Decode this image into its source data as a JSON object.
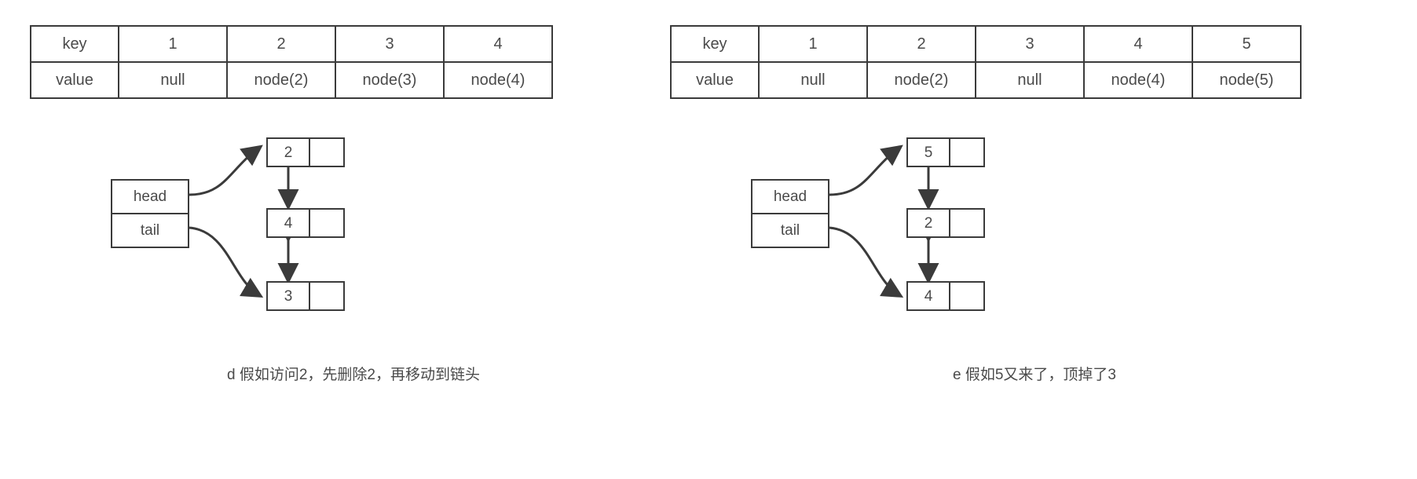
{
  "background_color": "#ffffff",
  "stroke_color": "#3b3b3b",
  "text_color": "#4a4a4a",
  "panels": [
    {
      "id": "d",
      "table": {
        "rows": [
          {
            "header": "key",
            "cells": [
              "1",
              "2",
              "3",
              "4"
            ]
          },
          {
            "header": "value",
            "cells": [
              "null",
              "node(2)",
              "node(3)",
              "node(4)"
            ]
          }
        ]
      },
      "list_box": {
        "head_label": "head",
        "tail_label": "tail"
      },
      "nodes": [
        {
          "value": "2",
          "position": "top"
        },
        {
          "value": "4",
          "position": "middle"
        },
        {
          "value": "3",
          "position": "bottom"
        }
      ],
      "caption": "d 假如访问2，先删除2，再移动到链头"
    },
    {
      "id": "e",
      "table": {
        "rows": [
          {
            "header": "key",
            "cells": [
              "1",
              "2",
              "3",
              "4",
              "5"
            ]
          },
          {
            "header": "value",
            "cells": [
              "null",
              "node(2)",
              "null",
              "node(4)",
              "node(5)"
            ]
          }
        ]
      },
      "list_box": {
        "head_label": "head",
        "tail_label": "tail"
      },
      "nodes": [
        {
          "value": "5",
          "position": "top"
        },
        {
          "value": "2",
          "position": "middle"
        },
        {
          "value": "4",
          "position": "bottom"
        }
      ],
      "caption": "e 假如5又来了，顶掉了3"
    }
  ]
}
